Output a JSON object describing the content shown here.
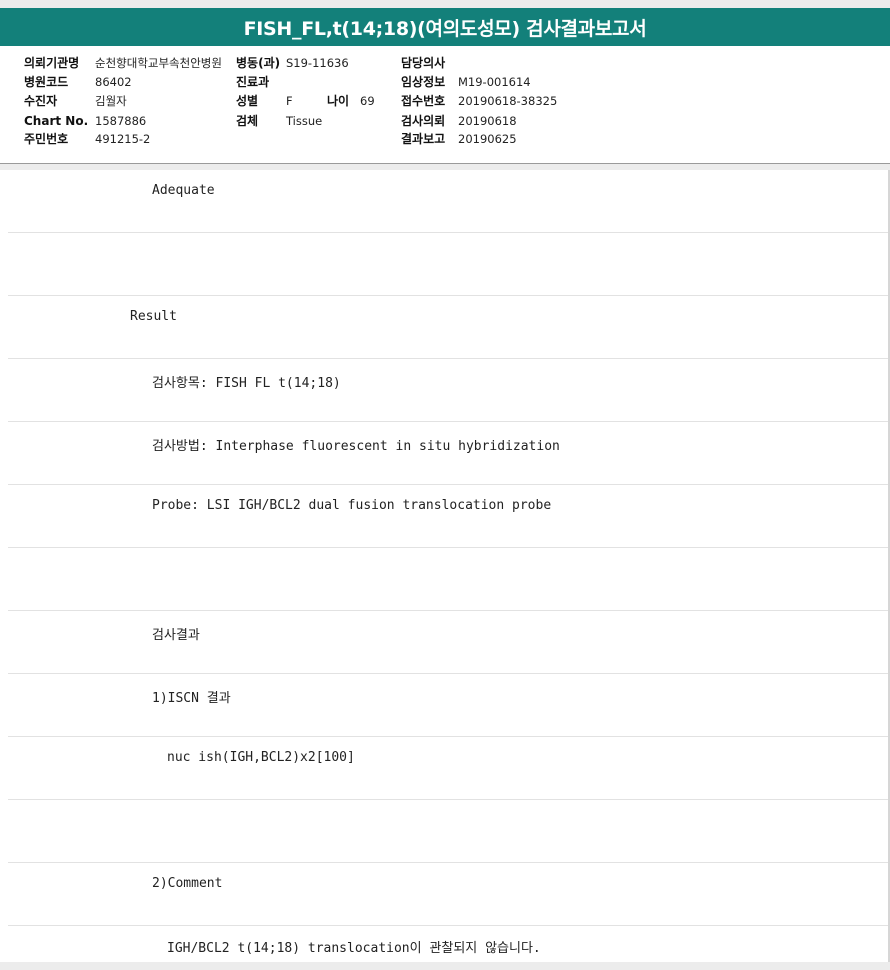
{
  "title": "FISH_FL,t(14;18)(여의도성모) 검사결과보고서",
  "info": {
    "institution_label": "의뢰기관명",
    "institution_value": "순천향대학교부속천안병원",
    "ward_label": "병동(과)",
    "ward_value": "S19-11636",
    "doctor_label": "담당의사",
    "doctor_value": "",
    "hospital_code_label": "병원코드",
    "hospital_code_value": "86402",
    "dept_label": "진료과",
    "dept_value": "",
    "clinical_label": "임상정보",
    "clinical_value": "M19-001614",
    "patient_label": "수진자",
    "patient_value": "김월자",
    "sex_label": "성별",
    "sex_value": "F",
    "age_label": "나이",
    "age_value": "69",
    "receipt_label": "접수번호",
    "receipt_value": "20190618-38325",
    "chart_label": "Chart No.",
    "chart_value": "1587886",
    "specimen_label": "검체",
    "specimen_value": "Tissue",
    "request_label": "검사의뢰",
    "request_value": "20190618",
    "id_label": "주민번호",
    "id_value": "491215-2",
    "report_label": "결과보고",
    "report_value": "20190625"
  },
  "report_lines": [
    "Adequate",
    "",
    "Result",
    "검사항목: FISH FL t(14;18)",
    "검사방법: Interphase fluorescent in situ hybridization",
    "Probe: LSI IGH/BCL2 dual fusion translocation probe",
    "",
    "검사결과",
    "1)ISCN 결과",
    "nuc ish(IGH,BCL2)x2[100]",
    "",
    "2)Comment",
    "IGH/BCL2 t(14;18) translocation이 관찰되지 않습니다."
  ]
}
